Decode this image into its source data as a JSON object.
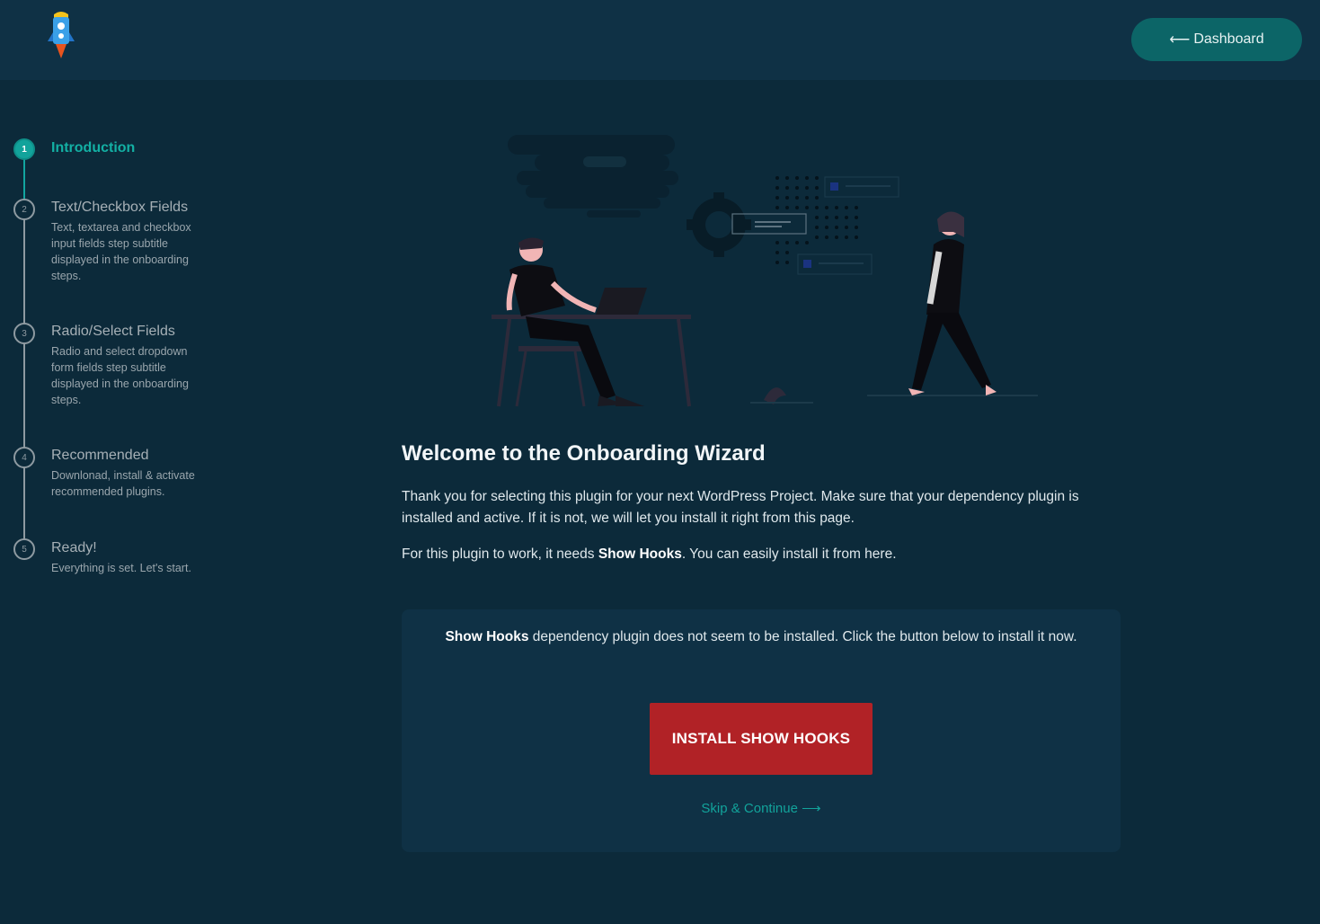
{
  "header": {
    "logo_icon": "rocket-icon",
    "dashboard_button": {
      "arrow": "⟵",
      "label": "Dashboard"
    }
  },
  "steps": [
    {
      "number": "1",
      "title": "Introduction",
      "subtitle": "",
      "active": true
    },
    {
      "number": "2",
      "title": "Text/Checkbox Fields",
      "subtitle": "Text, textarea and checkbox input fields step subtitle displayed in the onboarding steps."
    },
    {
      "number": "3",
      "title": "Radio/Select Fields",
      "subtitle": "Radio and select dropdown form fields step subtitle displayed in the onboarding steps."
    },
    {
      "number": "4",
      "title": "Recommended",
      "subtitle": "Downlonad, install & activate recommended plugins."
    },
    {
      "number": "5",
      "title": "Ready!",
      "subtitle": "Everything is set. Let's start."
    }
  ],
  "main": {
    "title": "Welcome to the Onboarding Wizard",
    "intro": "Thank you for selecting this plugin for your next WordPress Project. Make sure that your dependency plugin is installed and active. If it is not, we will let you install it right from this page.",
    "needs_prefix": "For this plugin to work, it needs ",
    "needs_plugin": "Show Hooks",
    "needs_suffix": ". You can easily install it from here."
  },
  "card": {
    "plugin_name": "Show Hooks",
    "message": " dependency plugin does not seem to be installed. Click the button below to install it now.",
    "install_label": "INSTALL SHOW HOOKS",
    "skip_label": "Skip & Continue ⟶"
  },
  "colors": {
    "background": "#0c2a3a",
    "topbar": "#0f3145",
    "accent": "#12a39b",
    "install_button": "#b12226"
  }
}
